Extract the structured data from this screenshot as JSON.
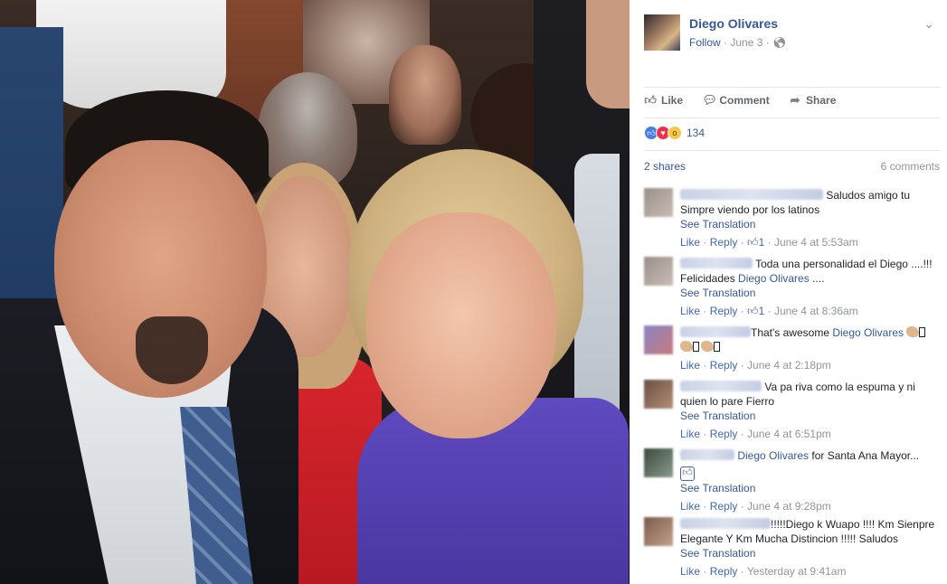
{
  "post": {
    "author": "Diego Olivares",
    "follow": "Follow",
    "date": "June 3",
    "actions": {
      "like": "Like",
      "comment": "Comment",
      "share": "Share"
    },
    "reactions_count": "134",
    "shares": "2 shares",
    "comments_count": "6 comments"
  },
  "comments": [
    {
      "text": "Saludos amigo tu Simpre viendo por los latinos",
      "see_translation": "See Translation",
      "like": "Like",
      "reply": "Reply",
      "likes": "1",
      "time": "June 4 at 5:53am"
    },
    {
      "text_a": "Toda una personalidad el Diego ....!!! Felicidades ",
      "mention": "Diego Olivares",
      "text_b": " ....",
      "see_translation": "See Translation",
      "like": "Like",
      "reply": "Reply",
      "likes": "1",
      "time": "June 4 at 8:36am"
    },
    {
      "text": "That's awesome ",
      "mention": "Diego Olivares",
      "like": "Like",
      "reply": "Reply",
      "time": "June 4 at 2:18pm"
    },
    {
      "text": "Va pa riva como la espuma y ni quien lo pare Fierro",
      "see_translation": "See Translation",
      "like": "Like",
      "reply": "Reply",
      "time": "June 4 at 6:51pm"
    },
    {
      "mention": "Diego Olivares",
      "text": " for Santa Ana Mayor...",
      "see_translation": "See Translation",
      "like": "Like",
      "reply": "Reply",
      "time": "June 4 at 9:28pm"
    },
    {
      "text": "!!!!!Diego k Wuapo !!!! Km Sienpre Elegante Y Km Mucha Distincion !!!!! Saludos",
      "see_translation": "See Translation",
      "like": "Like",
      "reply": "Reply",
      "time": "Yesterday at 9:41am"
    }
  ],
  "icons": {
    "chevron": "chevron-down-icon",
    "globe": "globe-icon",
    "like": "thumbs-up-icon",
    "comment": "speech-bubble-icon",
    "share": "share-arrow-icon"
  },
  "colors": {
    "link": "#365899",
    "meta": "#90949c",
    "like_blue": "#4b7ce6",
    "love_red": "#f0304a"
  }
}
